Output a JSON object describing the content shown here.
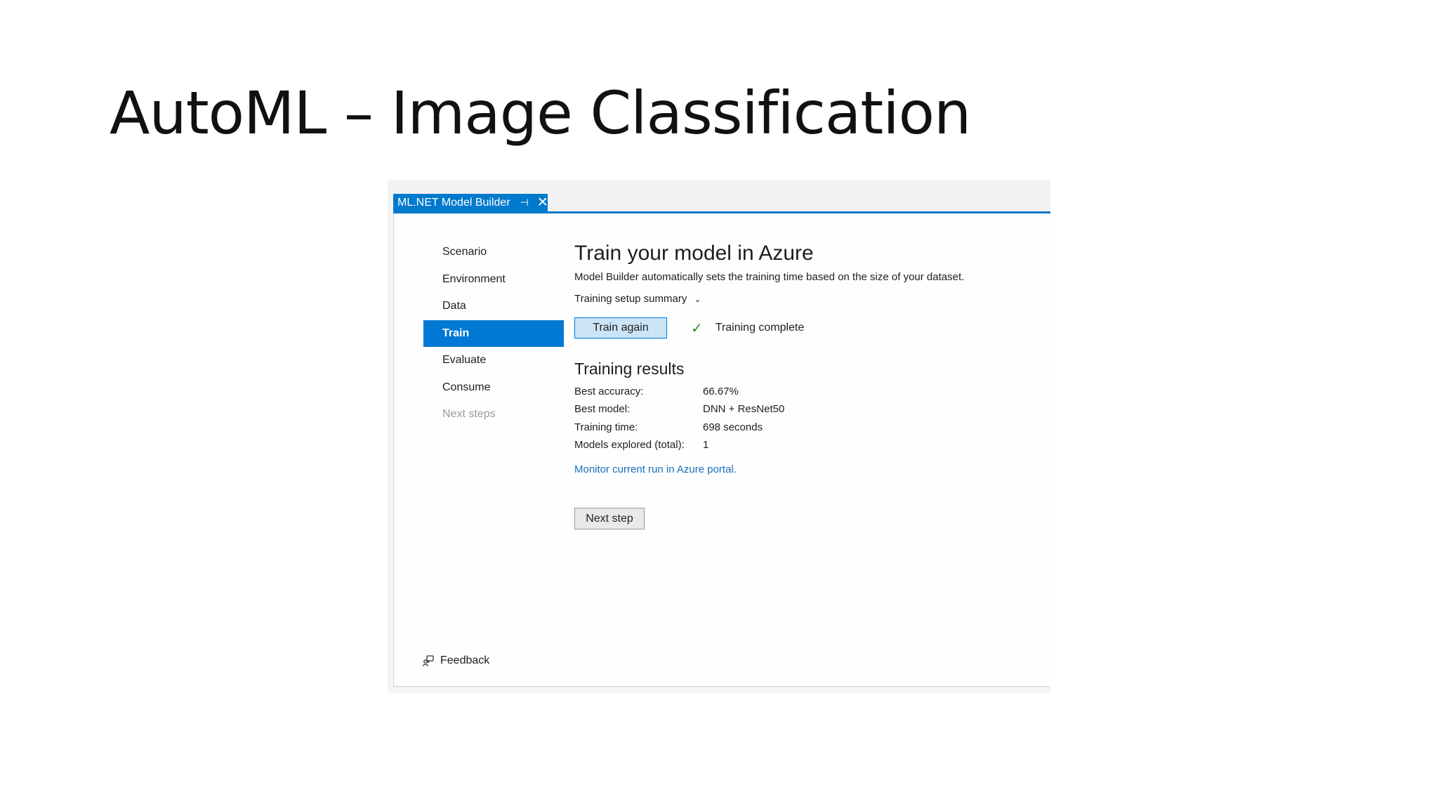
{
  "slide": {
    "title": "AutoML – Image Classification"
  },
  "window": {
    "tab_label": "ML.NET Model Builder",
    "pin_glyph": "⊣",
    "close_glyph": "✕",
    "accent_color": "#007acc"
  },
  "nav": {
    "items": [
      {
        "label": "Scenario",
        "state": "normal"
      },
      {
        "label": "Environment",
        "state": "normal"
      },
      {
        "label": "Data",
        "state": "normal"
      },
      {
        "label": "Train",
        "state": "active"
      },
      {
        "label": "Evaluate",
        "state": "normal"
      },
      {
        "label": "Consume",
        "state": "normal"
      },
      {
        "label": "Next steps",
        "state": "disabled"
      }
    ]
  },
  "main": {
    "title": "Train your model in Azure",
    "description": "Model Builder automatically sets the training time based on the size of your dataset.",
    "setup_summary_label": "Training setup summary",
    "chevron_glyph": "⌄",
    "train_button_label": "Train again",
    "check_glyph": "✓",
    "status_text": "Training complete",
    "results_heading": "Training results",
    "results": [
      {
        "label": "Best accuracy:",
        "value": "66.67%"
      },
      {
        "label": "Best model:",
        "value": "DNN + ResNet50"
      },
      {
        "label": "Training time:",
        "value": "698 seconds"
      },
      {
        "label": "Models explored (total):",
        "value": "1"
      }
    ],
    "azure_link_text": "Monitor current run in Azure portal.",
    "next_button_label": "Next step"
  },
  "footer": {
    "feedback_label": "Feedback",
    "feedback_icon": "feedback-icon"
  }
}
